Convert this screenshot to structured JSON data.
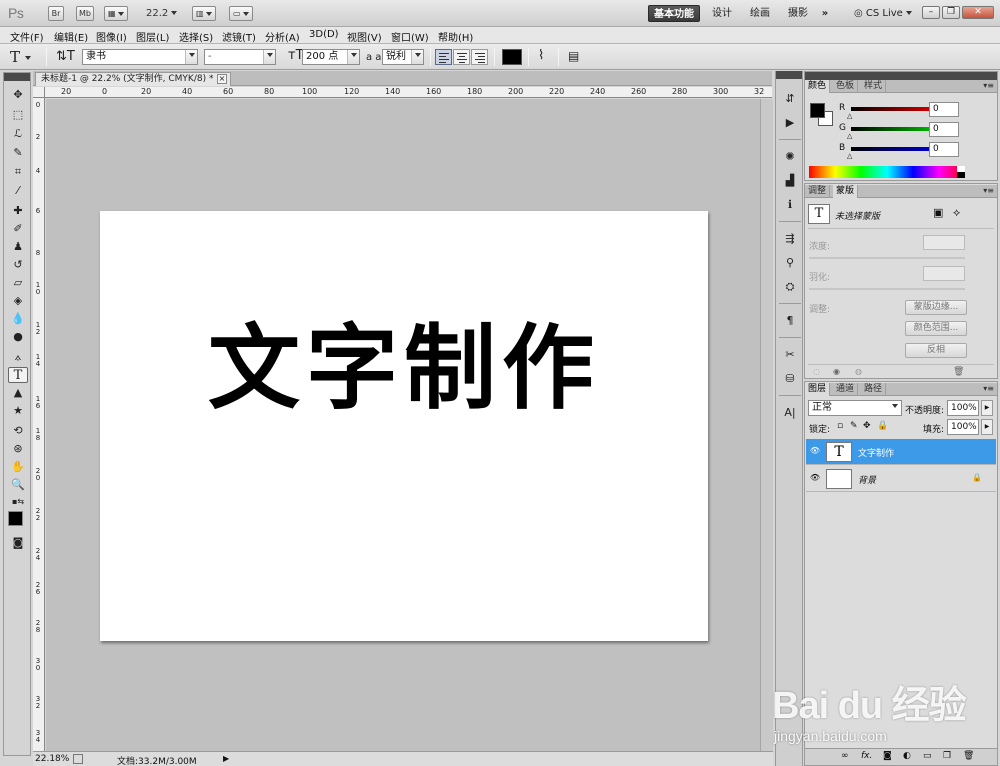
{
  "app": {
    "logo": "Ps",
    "mini_buttons": [
      "Br",
      "Mb"
    ],
    "zoom": "22.2",
    "workspaces": [
      "基本功能",
      "设计",
      "绘画",
      "摄影"
    ],
    "workspace_more": "»",
    "cs_live": "CS Live"
  },
  "menu": [
    "文件(F)",
    "编辑(E)",
    "图像(I)",
    "图层(L)",
    "选择(S)",
    "滤镜(T)",
    "分析(A)",
    "3D(D)",
    "视图(V)",
    "窗口(W)",
    "帮助(H)"
  ],
  "options": {
    "tool_label": "T",
    "font_family": "隶书",
    "font_style": "-",
    "font_size": "200 点",
    "aa_label": "a a",
    "anti_alias": "锐利",
    "text_color": "#000000"
  },
  "document": {
    "tab_title": "未标题-1 @ 22.2% (文字制作, CMYK/8) *",
    "tab_close": "×",
    "text": "文字制作",
    "ruler_h": [
      "20",
      "0",
      "20",
      "40",
      "60",
      "80",
      "100",
      "120",
      "140",
      "160",
      "180",
      "200",
      "220",
      "240",
      "260",
      "280",
      "300",
      "32"
    ],
    "ruler_v": [
      "0",
      "2",
      "4",
      "6",
      "8",
      "10",
      "12",
      "14",
      "16",
      "18",
      "20",
      "22",
      "24",
      "26",
      "28",
      "30",
      "32",
      "34",
      "36",
      "38"
    ],
    "status_zoom": "22.18%",
    "status_doc": "文档:33.2M/3.00M"
  },
  "color_panel": {
    "tabs": [
      "颜色",
      "色板",
      "样式"
    ],
    "channels": [
      {
        "label": "R",
        "value": "0",
        "color": "#cc0000"
      },
      {
        "label": "G",
        "value": "0",
        "color": "#00b000"
      },
      {
        "label": "B",
        "value": "0",
        "color": "#0000cc"
      }
    ]
  },
  "adjust_panel": {
    "tabs": [
      "调整",
      "蒙版"
    ],
    "mask_label": "未选择蒙版",
    "density_label": "浓度:",
    "feather_label": "羽化:",
    "refine_label": "调整:",
    "buttons": [
      "蒙版边缘...",
      "颜色范围...",
      "反相"
    ]
  },
  "layers_panel": {
    "tabs": [
      "图层",
      "通道",
      "路径"
    ],
    "blend_mode": "正常",
    "opacity_label": "不透明度:",
    "opacity": "100%",
    "lock_label": "锁定:",
    "fill_label": "填充:",
    "fill": "100%",
    "layers": [
      {
        "name": "文字制作",
        "thumb": "T",
        "selected": true
      },
      {
        "name": "背景",
        "thumb": "",
        "selected": false
      }
    ],
    "footer_icons": [
      "link-icon",
      "fx-icon",
      "mask-icon",
      "adjustment-icon",
      "group-icon",
      "new-layer-icon",
      "trash-icon"
    ]
  },
  "watermark": {
    "logo": "Bai du 经验",
    "url": "jingyan.baidu.com"
  }
}
